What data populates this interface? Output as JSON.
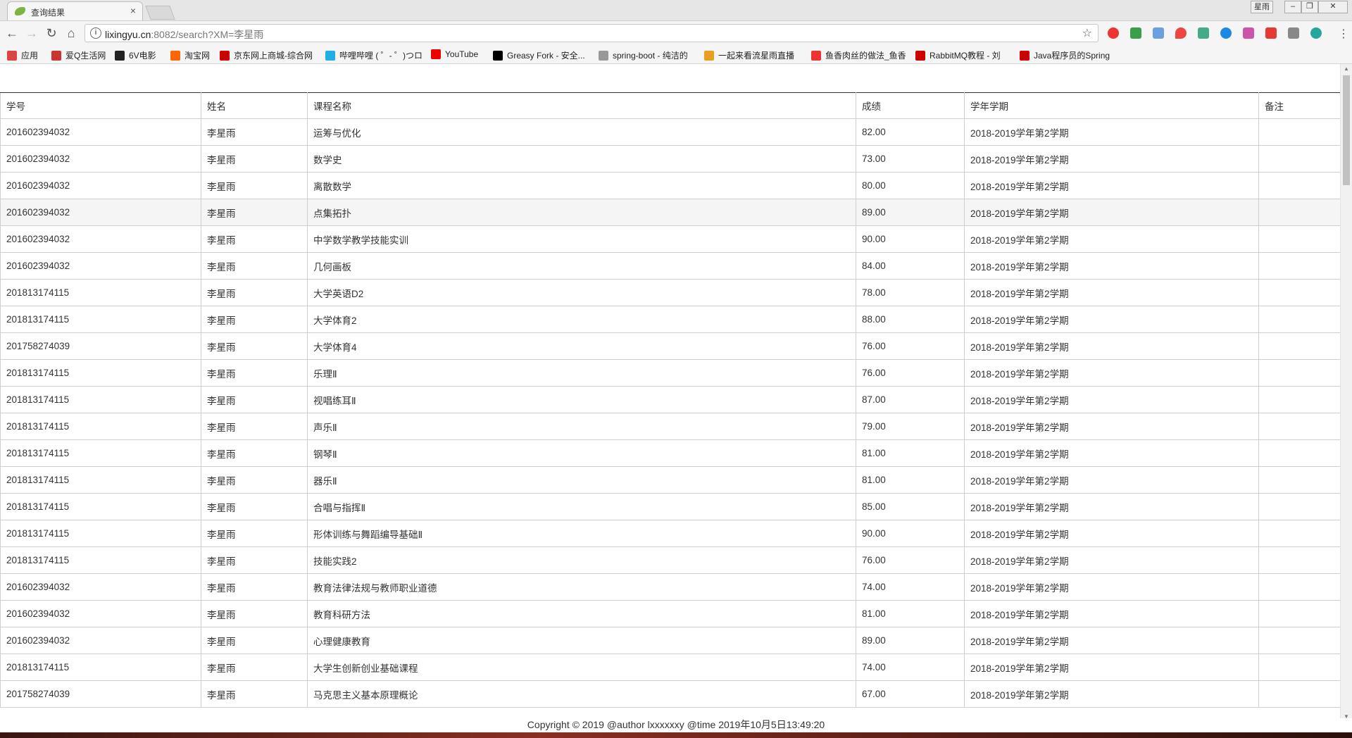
{
  "browser": {
    "tab_title": "查询结果",
    "tab_close": "×",
    "url_host": "lixingyu.cn",
    "url_path": ":8082/search?XM=李星雨",
    "user_label": "星雨"
  },
  "bookmarks": [
    {
      "label": "应用",
      "color": "#d44"
    },
    {
      "label": "爱Q生活网",
      "color": "#c33"
    },
    {
      "label": "6V电影",
      "color": "#222"
    },
    {
      "label": "淘宝网",
      "color": "#f60"
    },
    {
      "label": "京东网上商城-综合网",
      "color": "#c00"
    },
    {
      "label": "哔哩哔哩 ( ゜- ゜)つロ",
      "color": "#23ade5"
    },
    {
      "label": "YouTube",
      "color": "#e00"
    },
    {
      "label": "Greasy Fork - 安全...",
      "color": "#000"
    },
    {
      "label": "spring-boot - 纯洁的",
      "color": "#999"
    },
    {
      "label": "一起来看流星雨直播",
      "color": "#e8a020"
    },
    {
      "label": "鱼香肉丝的做法_鱼香",
      "color": "#e33"
    },
    {
      "label": "RabbitMQ教程 - 刘",
      "color": "#c00"
    },
    {
      "label": "Java程序员的Spring",
      "color": "#c00"
    }
  ],
  "table": {
    "headers": [
      "学号",
      "姓名",
      "课程名称",
      "成绩",
      "学年学期",
      "备注"
    ],
    "rows": [
      [
        "201602394032",
        "李星雨",
        "运筹与优化",
        "82.00",
        "2018-2019学年第2学期",
        ""
      ],
      [
        "201602394032",
        "李星雨",
        "数学史",
        "73.00",
        "2018-2019学年第2学期",
        ""
      ],
      [
        "201602394032",
        "李星雨",
        "离散数学",
        "80.00",
        "2018-2019学年第2学期",
        ""
      ],
      [
        "201602394032",
        "李星雨",
        "点集拓扑",
        "89.00",
        "2018-2019学年第2学期",
        ""
      ],
      [
        "201602394032",
        "李星雨",
        "中学数学教学技能实训",
        "90.00",
        "2018-2019学年第2学期",
        ""
      ],
      [
        "201602394032",
        "李星雨",
        "几何画板",
        "84.00",
        "2018-2019学年第2学期",
        ""
      ],
      [
        "201813174115",
        "李星雨",
        "大学英语D2",
        "78.00",
        "2018-2019学年第2学期",
        ""
      ],
      [
        "201813174115",
        "李星雨",
        "大学体育2",
        "88.00",
        "2018-2019学年第2学期",
        ""
      ],
      [
        "201758274039",
        "李星雨",
        "大学体育4",
        "76.00",
        "2018-2019学年第2学期",
        ""
      ],
      [
        "201813174115",
        "李星雨",
        "乐理Ⅱ",
        "76.00",
        "2018-2019学年第2学期",
        ""
      ],
      [
        "201813174115",
        "李星雨",
        "视唱练耳Ⅱ",
        "87.00",
        "2018-2019学年第2学期",
        ""
      ],
      [
        "201813174115",
        "李星雨",
        "声乐Ⅱ",
        "79.00",
        "2018-2019学年第2学期",
        ""
      ],
      [
        "201813174115",
        "李星雨",
        "钢琴Ⅱ",
        "81.00",
        "2018-2019学年第2学期",
        ""
      ],
      [
        "201813174115",
        "李星雨",
        "器乐Ⅱ",
        "81.00",
        "2018-2019学年第2学期",
        ""
      ],
      [
        "201813174115",
        "李星雨",
        "合唱与指挥Ⅱ",
        "85.00",
        "2018-2019学年第2学期",
        ""
      ],
      [
        "201813174115",
        "李星雨",
        "形体训练与舞蹈编导基础Ⅱ",
        "90.00",
        "2018-2019学年第2学期",
        ""
      ],
      [
        "201813174115",
        "李星雨",
        "技能实践2",
        "76.00",
        "2018-2019学年第2学期",
        ""
      ],
      [
        "201602394032",
        "李星雨",
        "教育法律法规与教师职业道德",
        "74.00",
        "2018-2019学年第2学期",
        ""
      ],
      [
        "201602394032",
        "李星雨",
        "教育科研方法",
        "81.00",
        "2018-2019学年第2学期",
        ""
      ],
      [
        "201602394032",
        "李星雨",
        "心理健康教育",
        "89.00",
        "2018-2019学年第2学期",
        ""
      ],
      [
        "201813174115",
        "李星雨",
        "大学生创新创业基础课程",
        "74.00",
        "2018-2019学年第2学期",
        ""
      ],
      [
        "201758274039",
        "李星雨",
        "马克思主义基本原理概论",
        "67.00",
        "2018-2019学年第2学期",
        ""
      ]
    ]
  },
  "footer": {
    "text": "Copyright © 2019 @author lxxxxxxy @time 2019年10月5日13:49:20"
  }
}
